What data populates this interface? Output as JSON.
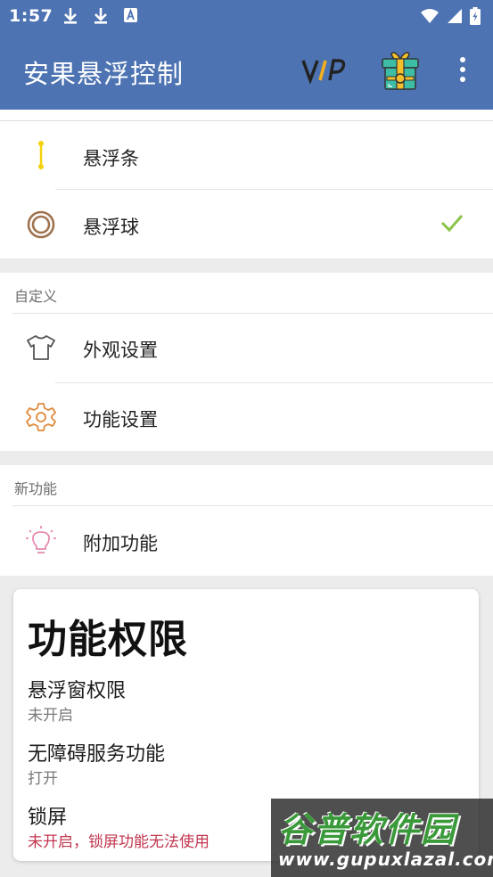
{
  "status_bar": {
    "time": "1:57"
  },
  "app_bar": {
    "title": "安果悬浮控制",
    "vip_label": "VIP"
  },
  "styles": {
    "items": [
      {
        "label": "悬浮条",
        "icon": "line-icon",
        "selected": false
      },
      {
        "label": "悬浮球",
        "icon": "ring-icon",
        "selected": true
      }
    ]
  },
  "custom": {
    "header": "自定义",
    "items": [
      {
        "label": "外观设置",
        "icon": "tshirt-icon"
      },
      {
        "label": "功能设置",
        "icon": "gear-icon"
      }
    ]
  },
  "new_features": {
    "header": "新功能",
    "items": [
      {
        "label": "附加功能",
        "icon": "lightbulb-icon"
      }
    ]
  },
  "permissions": {
    "title": "功能权限",
    "items": [
      {
        "name": "悬浮窗权限",
        "status": "未开启"
      },
      {
        "name": "无障碍服务功能",
        "status": "打开"
      },
      {
        "name": "锁屏",
        "status": "未开启，锁屏功能无法使用"
      }
    ]
  },
  "watermark": {
    "line1": "谷普软件园",
    "line2": "www.gupuxlazal.com"
  },
  "colors": {
    "app_bar": "#4d73b2",
    "check": "#8bc34a",
    "warning": "#c2364f"
  }
}
